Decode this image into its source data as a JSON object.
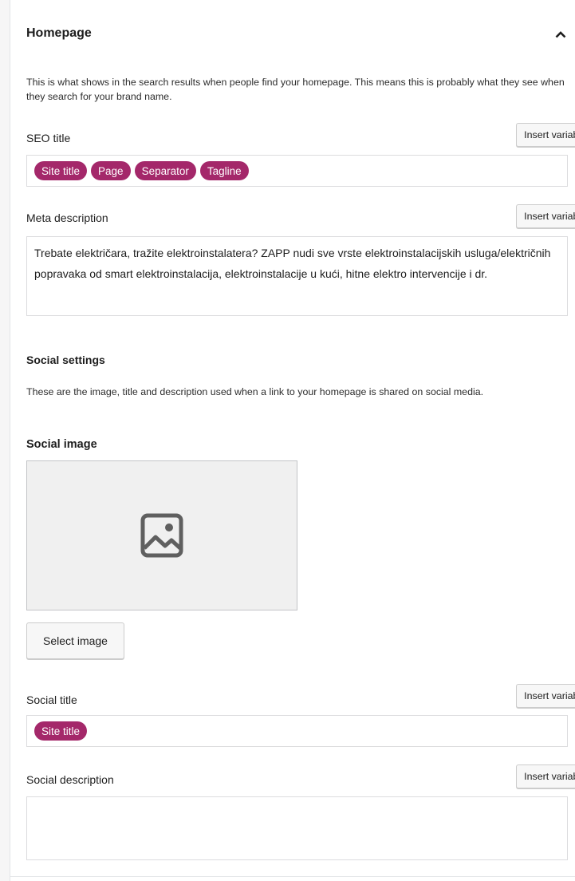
{
  "section": {
    "title": "Homepage",
    "intro": "This is what shows in the search results when people find your homepage. This means this is probably what they see when they search for your brand name."
  },
  "seo_title": {
    "label": "SEO title",
    "insert_variable": "Insert variable",
    "pills": [
      "Site title",
      "Page",
      "Separator",
      "Tagline"
    ]
  },
  "meta_description": {
    "label": "Meta description",
    "insert_variable": "Insert variable",
    "value": "Trebate električara, tražite elektroinstalatera? ZAPP nudi sve vrste elektroinstalacijskih usluga/električnih popravaka od smart elektroinstalacija, elektroinstalacije u kući, hitne elektro intervencije i dr."
  },
  "social": {
    "heading": "Social settings",
    "intro": "These are the image, title and description used when a link to your homepage is shared on social media.",
    "image_label": "Social image",
    "select_image": "Select image",
    "title_label": "Social title",
    "title_insert_variable": "Insert variable",
    "title_pills": [
      "Site title"
    ],
    "description_label": "Social description",
    "description_insert_variable": "Insert variable",
    "description_value": ""
  },
  "colors": {
    "pill": "#a4286a",
    "button_bg": "#f7f7f7",
    "border": "#dcdcde"
  },
  "icons": {
    "collapse": "chevron-up-icon",
    "image_placeholder": "image-icon"
  }
}
